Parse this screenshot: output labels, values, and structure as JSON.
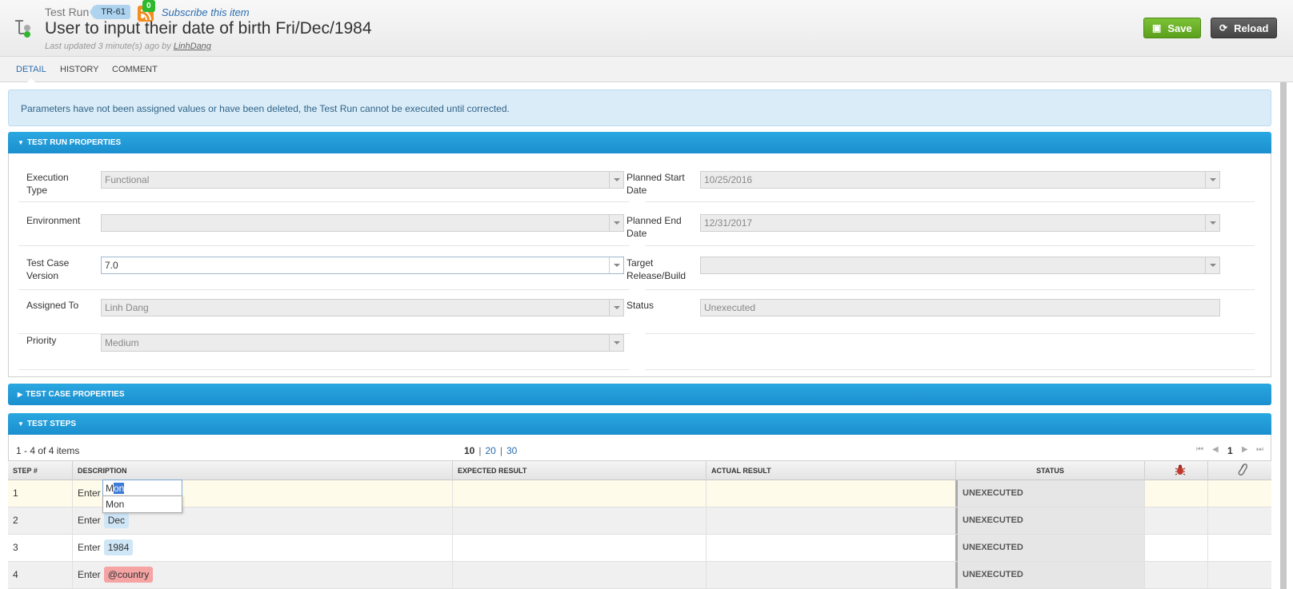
{
  "header": {
    "artifact_type": "Test Run",
    "artifact_id": "TR-61",
    "subscriber_count": "0",
    "subscribe_label": "Subscribe this item",
    "title": "User to input their date of birth Fri/Dec/1984",
    "updated_prefix": "Last updated 3 minute(s) ago by",
    "updated_by": "LinhDang",
    "save_label": "Save",
    "reload_label": "Reload"
  },
  "tabs": [
    "DETAIL",
    "HISTORY",
    "COMMENT"
  ],
  "alert": "Parameters have not been assigned values or have been deleted, the Test Run cannot be executed until corrected.",
  "test_run_properties": {
    "heading": "TEST RUN PROPERTIES",
    "execution_type_label": "Execution Type",
    "execution_type": "Functional",
    "environment_label": "Environment",
    "environment": "",
    "test_case_version_label": "Test Case Version",
    "test_case_version": "7.0",
    "assigned_to_label": "Assigned To",
    "assigned_to": "Linh Dang",
    "priority_label": "Priority",
    "priority": "Medium",
    "planned_start_label": "Planned Start Date",
    "planned_start": "10/25/2016",
    "planned_end_label": "Planned End Date",
    "planned_end": "12/31/2017",
    "target_release_label": "Target Release/Build",
    "target_release": "",
    "status_label": "Status",
    "status": "Unexecuted"
  },
  "test_case_properties": {
    "heading": "TEST CASE PROPERTIES"
  },
  "test_steps": {
    "heading": "TEST STEPS",
    "pager_info": "1 - 4 of 4 items",
    "page_sizes": [
      "10",
      "20",
      "30"
    ],
    "current_page": "1",
    "columns": [
      "STEP #",
      "DESCRIPTION",
      "EXPECTED RESULT",
      "ACTUAL RESULT",
      "STATUS"
    ],
    "rows": [
      {
        "step": "1",
        "desc_prefix": "Enter",
        "param": "Mon",
        "status": "UNEXECUTED"
      },
      {
        "step": "2",
        "desc_prefix": "Enter",
        "param": "Dec",
        "status": "UNEXECUTED"
      },
      {
        "step": "3",
        "desc_prefix": "Enter",
        "param": "1984",
        "status": "UNEXECUTED"
      },
      {
        "step": "4",
        "desc_prefix": "Enter",
        "param": "@country",
        "status": "UNEXECUTED"
      }
    ],
    "editor": {
      "typed": "M",
      "selected": "on",
      "suggestion": "Mon"
    }
  },
  "colors": {
    "accent": "#1b8fcf",
    "save": "#5aa01c",
    "reload": "#444444",
    "alert_bg": "#d9ecf7",
    "missing_param": "#f5a3a3"
  }
}
